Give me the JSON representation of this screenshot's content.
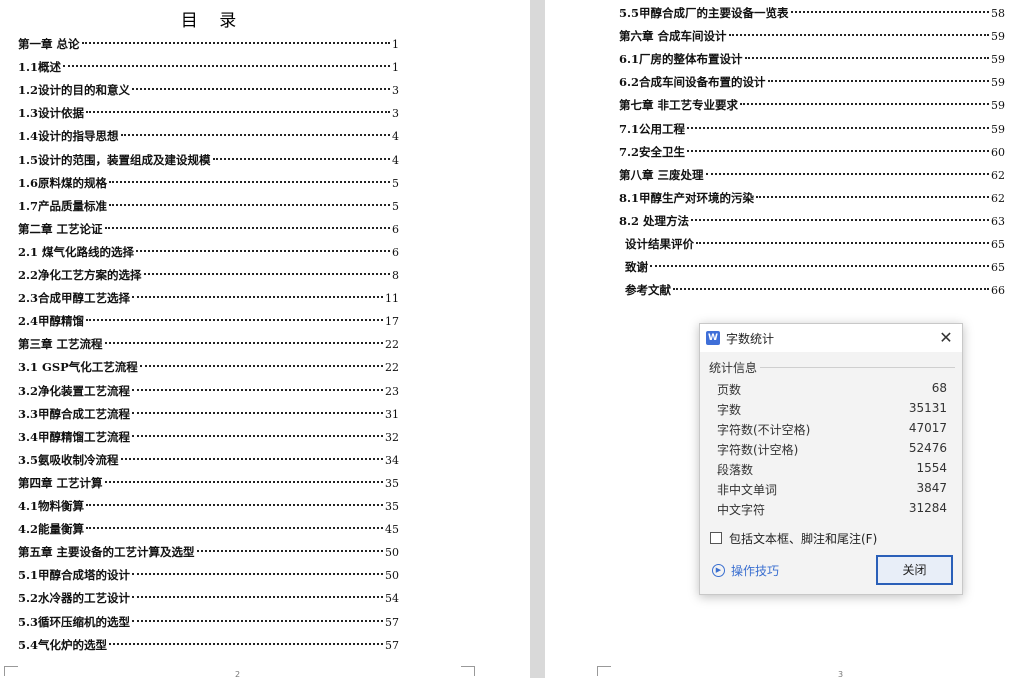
{
  "left_page": {
    "title": "目 录",
    "page_number": "2",
    "entries": [
      {
        "text": "第一章  总论",
        "page": "1"
      },
      {
        "text": "1.1概述",
        "page": "1"
      },
      {
        "text": "1.2设计的目的和意义",
        "page": "3"
      },
      {
        "text": "1.3设计依据",
        "page": "3"
      },
      {
        "text": "1.4设计的指导思想",
        "page": "4"
      },
      {
        "text": "1.5设计的范围，装置组成及建设规模",
        "page": "4"
      },
      {
        "text": "1.6原料煤的规格",
        "page": "5"
      },
      {
        "text": "1.7产品质量标准",
        "page": "5"
      },
      {
        "text": "第二章  工艺论证",
        "page": "6"
      },
      {
        "text": "2.1 煤气化路线的选择",
        "page": "6"
      },
      {
        "text": "2.2净化工艺方案的选择",
        "page": "8"
      },
      {
        "text": "2.3合成甲醇工艺选择",
        "page": "11"
      },
      {
        "text": "2.4甲醇精馏",
        "page": "17"
      },
      {
        "text": "第三章  工艺流程",
        "page": "22"
      },
      {
        "text": "3.1 GSP气化工艺流程",
        "page": "22"
      },
      {
        "text": "3.2净化装置工艺流程",
        "page": "23"
      },
      {
        "text": "3.3甲醇合成工艺流程",
        "page": "31"
      },
      {
        "text": "3.4甲醇精馏工艺流程",
        "page": "32"
      },
      {
        "text": "3.5氨吸收制冷流程",
        "page": "34"
      },
      {
        "text": "第四章  工艺计算",
        "page": "35"
      },
      {
        "text": "4.1物料衡算",
        "page": "35"
      },
      {
        "text": "4.2能量衡算",
        "page": "45"
      },
      {
        "text": "第五章  主要设备的工艺计算及选型",
        "page": "50"
      },
      {
        "text": "5.1甲醇合成塔的设计",
        "page": "50"
      },
      {
        "text": "5.2水冷器的工艺设计",
        "page": "54"
      },
      {
        "text": "5.3循环压缩机的选型",
        "page": "57"
      },
      {
        "text": "5.4气化炉的选型",
        "page": "57"
      }
    ]
  },
  "right_page": {
    "page_number": "3",
    "entries": [
      {
        "text": "5.5甲醇合成厂的主要设备一览表",
        "page": "58"
      },
      {
        "text": "第六章  合成车间设计",
        "page": "59"
      },
      {
        "text": "6.1厂房的整体布置设计",
        "page": "59"
      },
      {
        "text": "6.2合成车间设备布置的设计",
        "page": "59"
      },
      {
        "text": "第七章  非工艺专业要求",
        "page": "59"
      },
      {
        "text": "7.1公用工程",
        "page": "59"
      },
      {
        "text": "7.2安全卫生",
        "page": "60"
      },
      {
        "text": "第八章  三废处理",
        "page": "62"
      },
      {
        "text": "8.1甲醇生产对环境的污染",
        "page": "62"
      },
      {
        "text": "8.2 处理方法",
        "page": "63"
      },
      {
        "text": "设计结果评价",
        "page": "65"
      },
      {
        "text": "致谢",
        "page": "65"
      },
      {
        "text": "参考文献",
        "page": "66"
      }
    ]
  },
  "dialog": {
    "app_icon": "W",
    "title": "字数统计",
    "section_label": "统计信息",
    "stats": [
      {
        "label": "页数",
        "value": "68"
      },
      {
        "label": "字数",
        "value": "35131"
      },
      {
        "label": "字符数(不计空格)",
        "value": "47017"
      },
      {
        "label": "字符数(计空格)",
        "value": "52476"
      },
      {
        "label": "段落数",
        "value": "1554"
      },
      {
        "label": "非中文单词",
        "value": "3847"
      },
      {
        "label": "中文字符",
        "value": "31284"
      }
    ],
    "checkbox_label": "包括文本框、脚注和尾注(F)",
    "tips_label": "操作技巧",
    "close_label": "关闭"
  }
}
